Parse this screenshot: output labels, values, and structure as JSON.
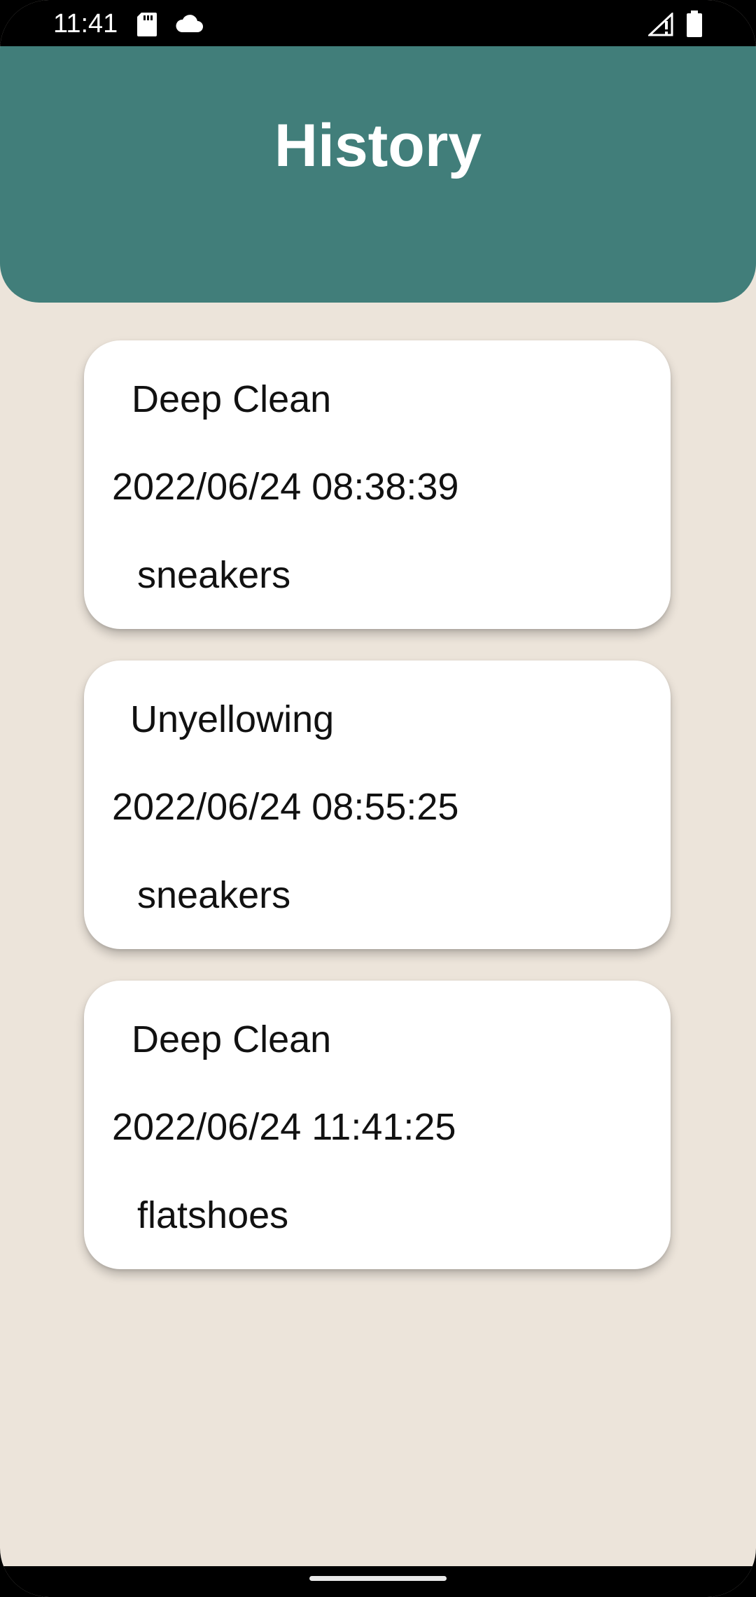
{
  "status_bar": {
    "time": "11:41",
    "icons": [
      "sd-card-icon",
      "cloud-icon",
      "signal-icon",
      "battery-icon"
    ]
  },
  "header": {
    "title": "History",
    "background_color": "#417e7a"
  },
  "history": [
    {
      "service": "Deep Clean",
      "datetime": "2022/06/24 08:38:39",
      "shoe_type": "sneakers"
    },
    {
      "service": "Unyellowing",
      "datetime": "2022/06/24 08:55:25",
      "shoe_type": "sneakers"
    },
    {
      "service": "Deep Clean",
      "datetime": "2022/06/24 11:41:25",
      "shoe_type": "flatshoes"
    }
  ],
  "colors": {
    "page_background": "#ece4da",
    "card_background": "#ffffff",
    "text": "#111111"
  }
}
